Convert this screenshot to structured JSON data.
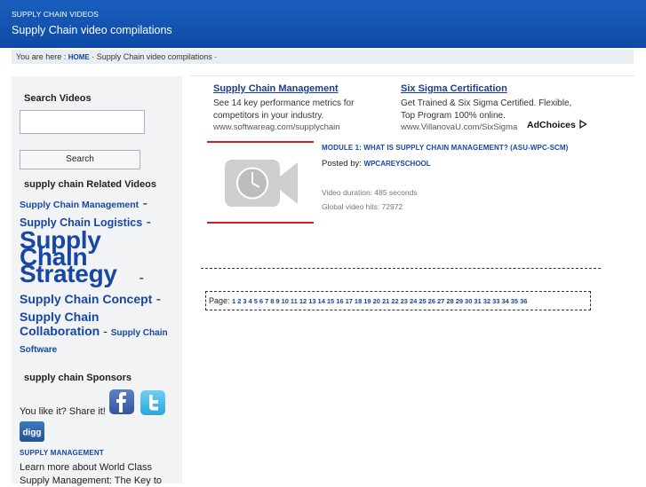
{
  "header": {
    "site_name": "SUPPLY CHAIN VIDEOS",
    "tagline": "Supply Chain video compilations"
  },
  "breadcrumb": {
    "prefix": "You are here : ",
    "home": "HOME",
    "current": " · Supply Chain video compilations ·"
  },
  "sidebar": {
    "search_title": "Search Videos",
    "search_placeholder": "",
    "search_button": "Search",
    "related_title": "supply chain Related Videos",
    "related_links": [
      {
        "label": "Supply Chain Management",
        "sep": " - "
      },
      {
        "label": "Supply Chain Logistics",
        "sep": " - "
      },
      {
        "label": "Supply Chain Strategy",
        "sep": " - "
      },
      {
        "label": "Supply Chain Concept",
        "sep": " - "
      },
      {
        "label": "Supply Chain Collaboration",
        "sep": " - "
      },
      {
        "label": "Supply Chain Software",
        "sep": ""
      }
    ],
    "sponsors_title": "supply chain Sponsors",
    "share_text": "You like it? Share it!",
    "share_icons": [
      "facebook-icon",
      "twitter-icon",
      "digg-icon"
    ],
    "digg_label": "digg",
    "sponsor_heading": "SUPPLY MANAGEMENT",
    "sponsor_text": "Learn more about World Class Supply Management: The Key to"
  },
  "ads": [
    {
      "title": "Supply Chain Management",
      "text": "See 14 key performance metrics for competitors in your industry.",
      "url": "www.softwareag.com/supplychain"
    },
    {
      "title": "Six Sigma Certification",
      "text": "Get Trained & Six Sigma Certified. Flexible, Top Program 100% online.",
      "url": "www.VillanovaU.com/SixSigma"
    }
  ],
  "adchoices_label": "AdChoices",
  "video": {
    "title": "MODULE 1: WHAT IS SUPPLY CHAIN MANAGEMENT? (ASU-WPC-SCM)",
    "posted_by_label": "Posted by: ",
    "author": "WPCAREYSCHOOL",
    "duration": "Video duration: 485 seconds",
    "hits": "Global video hits: 72972"
  },
  "pager": {
    "label": "Page: ",
    "pages": [
      "1",
      "2",
      "3",
      "4",
      "5",
      "6",
      "7",
      "8",
      "9",
      "10",
      "11",
      "12",
      "13",
      "14",
      "15",
      "16",
      "17",
      "18",
      "19",
      "20",
      "21",
      "22",
      "23",
      "24",
      "25",
      "26",
      "27",
      "28",
      "29",
      "30",
      "31",
      "32",
      "33",
      "34",
      "35",
      "36"
    ]
  },
  "colors": {
    "header_blue": "#1558b8",
    "link_blue": "#1747a6",
    "accent_red": "#cc2020"
  }
}
